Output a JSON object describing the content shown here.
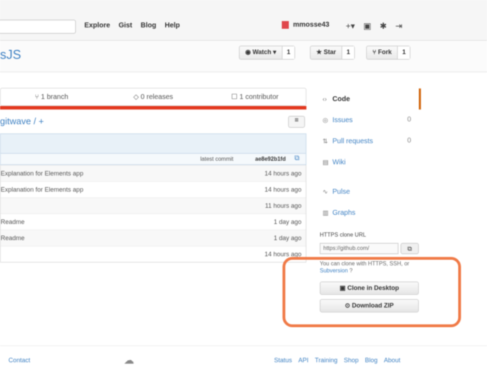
{
  "header": {
    "nav": [
      "Explore",
      "Gist",
      "Blog",
      "Help"
    ],
    "username": "mmosse43",
    "icons": [
      "plus-icon",
      "inbox-icon",
      "settings-icon",
      "signout-icon"
    ]
  },
  "repo": {
    "name": "sJS",
    "actions": [
      {
        "label": "Watch",
        "count": "1"
      },
      {
        "label": "Star",
        "count": "1"
      },
      {
        "label": "Fork",
        "count": "1"
      }
    ]
  },
  "numbers": {
    "branch": "1 branch",
    "releases": "0 releases",
    "contributors": "1 contributor"
  },
  "language_color": "#e3371e",
  "breadcrumb": "gitwave / +",
  "commit": {
    "latest_label": "latest commit",
    "sha": "ae8e92b1fd"
  },
  "files": [
    {
      "message": "Explanation for Elements app",
      "age": "14 hours ago"
    },
    {
      "message": "Explanation for Elements app",
      "age": "14 hours ago"
    },
    {
      "message": "",
      "age": "11 hours ago"
    },
    {
      "message": "Readme",
      "age": "1 day ago"
    },
    {
      "message": "Readme",
      "age": "1 day ago"
    },
    {
      "message": "",
      "age": "14 hours ago"
    }
  ],
  "sidebar": {
    "items": [
      {
        "label": "Code",
        "icon": "code-icon",
        "count": ""
      },
      {
        "label": "Issues",
        "icon": "issues-icon",
        "count": "0"
      },
      {
        "label": "Pull requests",
        "icon": "pull-request-icon",
        "count": "0"
      },
      {
        "label": "Wiki",
        "icon": "wiki-icon",
        "count": ""
      },
      {
        "label": "Pulse",
        "icon": "pulse-icon",
        "count": ""
      },
      {
        "label": "Graphs",
        "icon": "graphs-icon",
        "count": ""
      }
    ],
    "clone_label": "HTTPS clone URL",
    "clone_url": "https://github.com/",
    "clone_help_text": "You can clone with HTTPS, SSH, or",
    "clone_help_link": "Subversion",
    "clone_in_desktop": "Clone in Desktop",
    "download_zip": "Download ZIP"
  },
  "footer": {
    "left": "Contact",
    "links": [
      "Status",
      "API",
      "Training",
      "Shop",
      "Blog",
      "About"
    ]
  },
  "colors": {
    "highlight": "#f07a47",
    "link": "#4183c4"
  }
}
